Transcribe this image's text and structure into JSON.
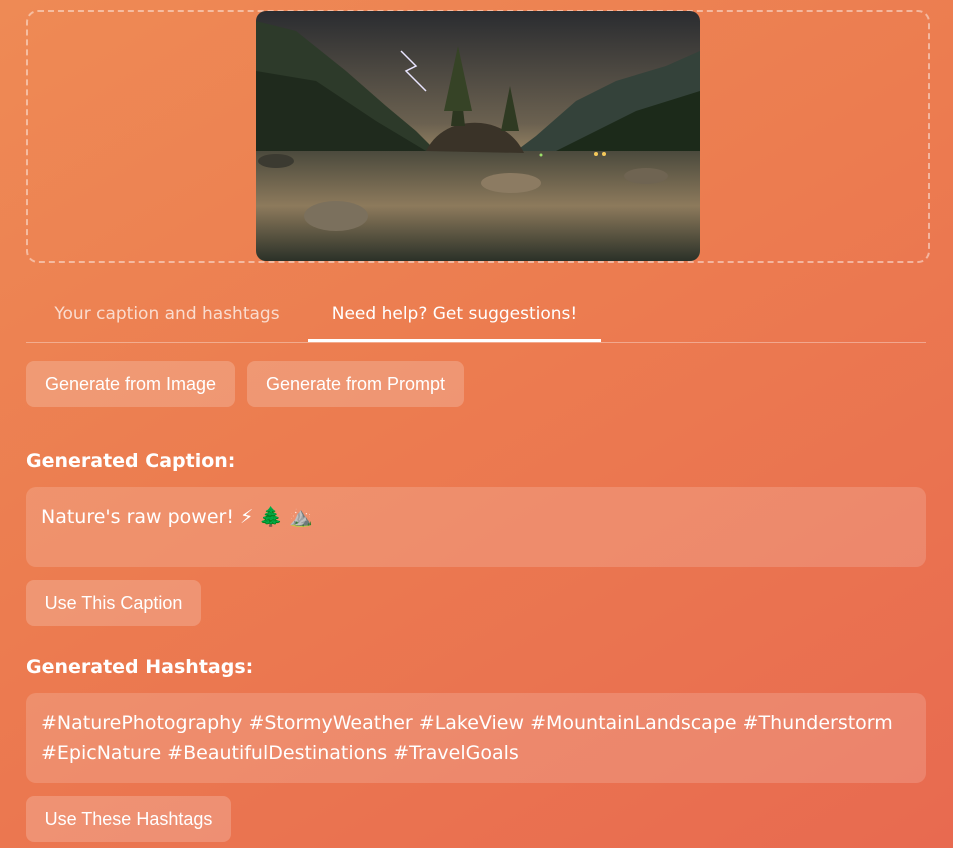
{
  "tabs": {
    "caption_tab": "Your caption and hashtags",
    "suggestions_tab": "Need help? Get suggestions!"
  },
  "actions": {
    "generate_from_image": "Generate from Image",
    "generate_from_prompt": "Generate from Prompt"
  },
  "caption": {
    "heading": "Generated Caption:",
    "text": "Nature's raw power! ⚡ 🌲 ⛰️",
    "use_button": "Use This Caption"
  },
  "hashtags": {
    "heading": "Generated Hashtags:",
    "text": "#NaturePhotography #StormyWeather #LakeView #MountainLandscape #Thunderstorm #EpicNature #BeautifulDestinations #TravelGoals",
    "use_button": "Use These Hashtags"
  },
  "colors": {
    "background_start": "#ee8a55",
    "background_end": "#e86a50",
    "text": "#ffffff"
  }
}
